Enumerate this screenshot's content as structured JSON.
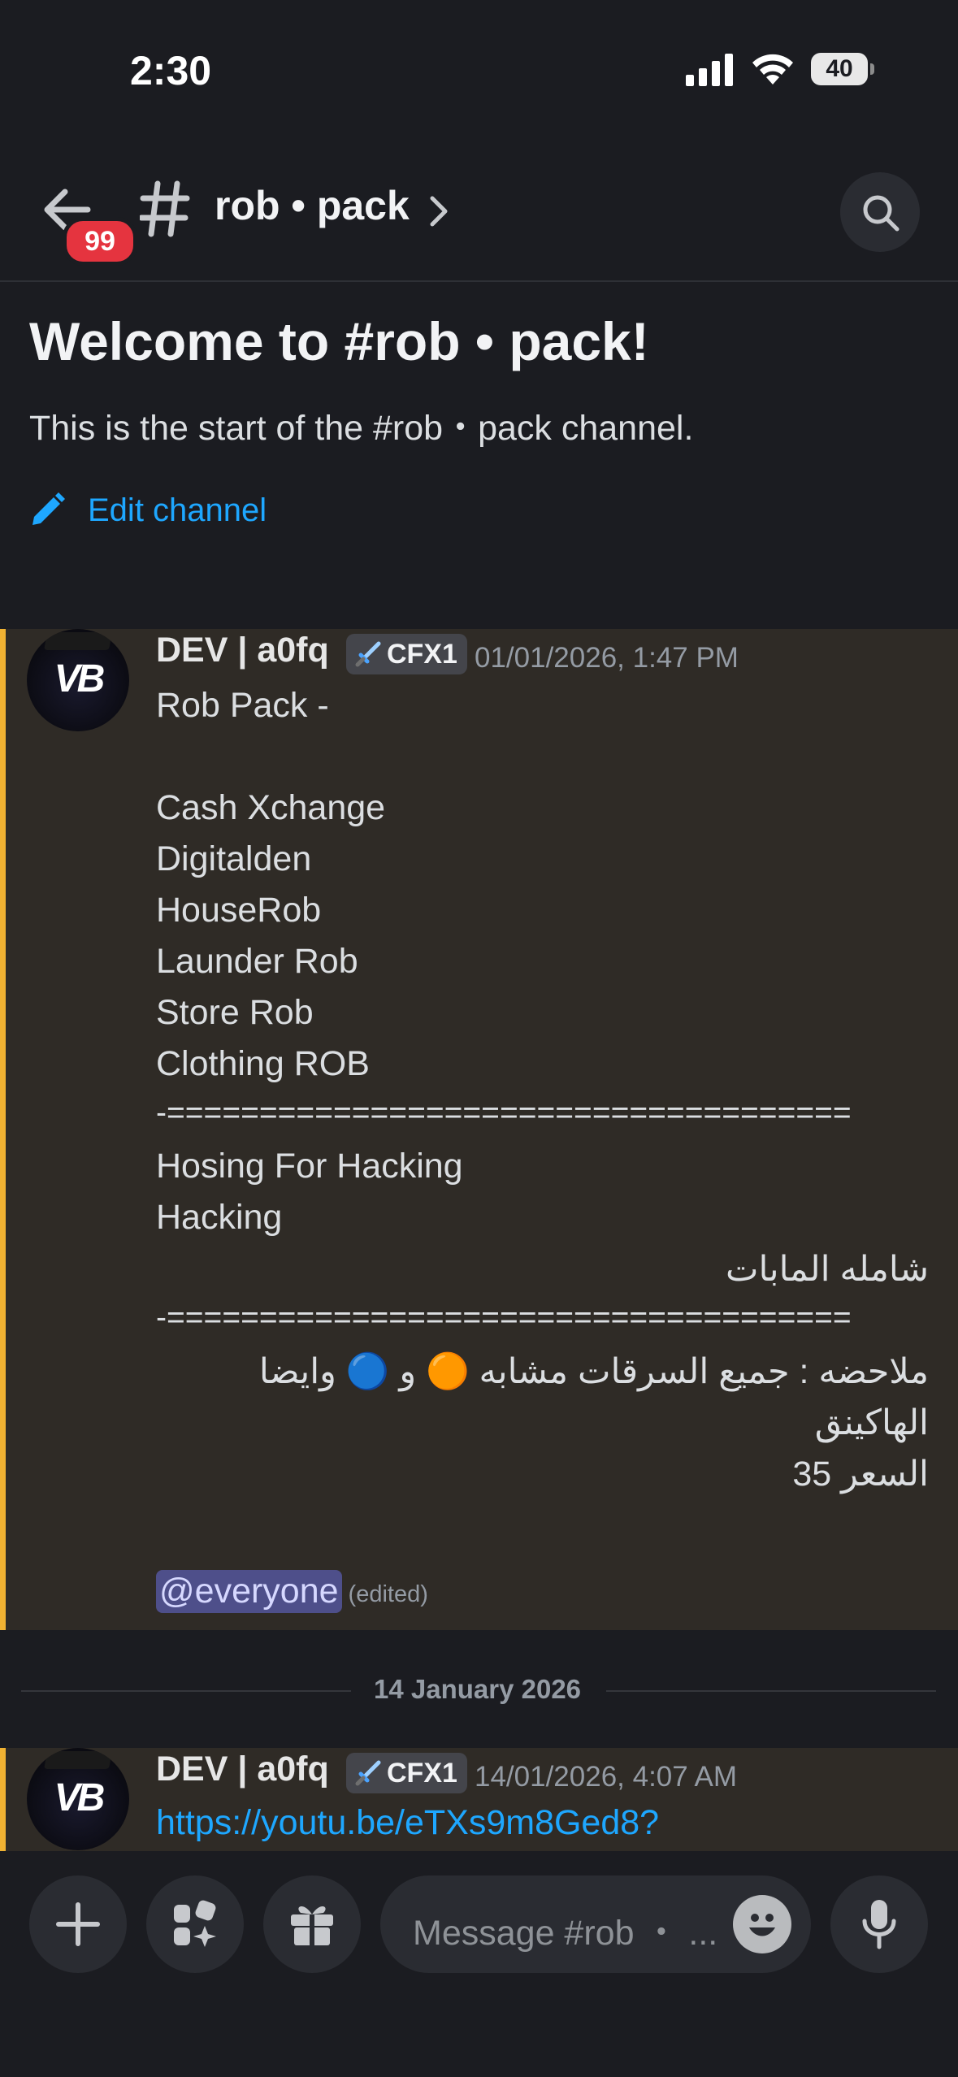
{
  "status_bar": {
    "time": "2:30",
    "battery": "40"
  },
  "header": {
    "badge_count": "99",
    "channel_name": "rob • pack"
  },
  "welcome": {
    "title": "Welcome to #rob • pack!",
    "subtitle": "This is the start of the #rob・pack channel.",
    "edit_label": "Edit channel"
  },
  "messages": [
    {
      "username": "DEV | a0fq",
      "tag": "CFX1",
      "timestamp": "01/01/2026, 1:47 PM",
      "lines": [
        "Rob Pack -",
        "Cash Xchange",
        "Digitalden",
        "HouseRob",
        "Launder Rob",
        "Store Rob",
        "Clothing ROB",
        "-=====================================",
        "Hosing For Hacking",
        "Hacking",
        "شامله المابات",
        "-=====================================",
        "ملاحضه : جميع السرقات مشابه 🟠 و 🔵  وايضا",
        "الهاكينق",
        "السعر 35"
      ],
      "mention": "@everyone",
      "edited": "(edited)"
    },
    {
      "username": "DEV | a0fq",
      "tag": "CFX1",
      "timestamp": "14/01/2026, 4:07 AM",
      "link": "https://youtu.be/eTXs9m8Ged8?"
    }
  ],
  "date_divider": "14 January 2026",
  "input": {
    "placeholder": "Message #rob ・ ..."
  },
  "colors": {
    "accent_link": "#1ea7ff",
    "highlight_bar": "#f0b232",
    "mention_bg": "#4e4f8a",
    "badge": "#e5343f"
  }
}
